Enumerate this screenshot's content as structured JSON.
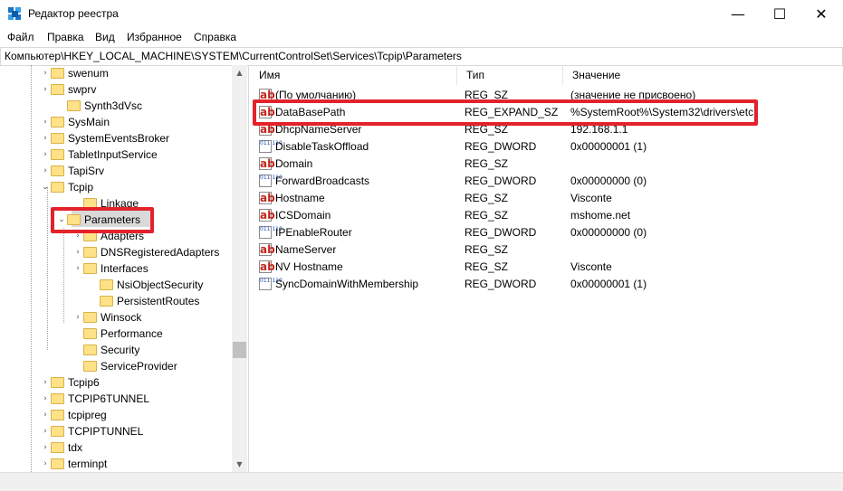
{
  "window": {
    "title": "Редактор реестра"
  },
  "controls": {
    "minimize": "—",
    "maximize": "☐",
    "close": "✕"
  },
  "menu": [
    "Файл",
    "Правка",
    "Вид",
    "Избранное",
    "Справка"
  ],
  "address": "Компьютер\\HKEY_LOCAL_MACHINE\\SYSTEM\\CurrentControlSet\\Services\\Tcpip\\Parameters",
  "tree": {
    "items": [
      {
        "label": "swenum",
        "chevron": "›"
      },
      {
        "label": "swprv",
        "chevron": "›"
      },
      {
        "label": "Synth3dVsc",
        "chevron": ""
      },
      {
        "label": "SysMain",
        "chevron": "›"
      },
      {
        "label": "SystemEventsBroker",
        "chevron": "›"
      },
      {
        "label": "TabletInputService",
        "chevron": "›"
      },
      {
        "label": "TapiSrv",
        "chevron": "›"
      },
      {
        "label": "Tcpip",
        "chevron": "⌄"
      },
      {
        "label": "Linkage",
        "chevron": ""
      },
      {
        "label": "Parameters",
        "chevron": "⌄"
      },
      {
        "label": "Adapters",
        "chevron": "›"
      },
      {
        "label": "DNSRegisteredAdapters",
        "chevron": "›"
      },
      {
        "label": "Interfaces",
        "chevron": "›"
      },
      {
        "label": "NsiObjectSecurity",
        "chevron": ""
      },
      {
        "label": "PersistentRoutes",
        "chevron": ""
      },
      {
        "label": "Winsock",
        "chevron": "›"
      },
      {
        "label": "Performance",
        "chevron": ""
      },
      {
        "label": "Security",
        "chevron": ""
      },
      {
        "label": "ServiceProvider",
        "chevron": ""
      },
      {
        "label": "Tcpip6",
        "chevron": "›"
      },
      {
        "label": "TCPIP6TUNNEL",
        "chevron": "›"
      },
      {
        "label": "tcpipreg",
        "chevron": "›"
      },
      {
        "label": "TCPIPTUNNEL",
        "chevron": "›"
      },
      {
        "label": "tdx",
        "chevron": "›"
      },
      {
        "label": "terminpt",
        "chevron": "›"
      }
    ]
  },
  "list": {
    "columns": {
      "name": "Имя",
      "type": "Тип",
      "value": "Значение"
    },
    "rows": [
      {
        "name": "(По умолчанию)",
        "type": "REG_SZ",
        "value": "(значение не присвоено)",
        "icon": "ab"
      },
      {
        "name": "DataBasePath",
        "type": "REG_EXPAND_SZ",
        "value": "%SystemRoot%\\System32\\drivers\\etc",
        "icon": "ab"
      },
      {
        "name": "DhcpNameServer",
        "type": "REG_SZ",
        "value": "192.168.1.1",
        "icon": "ab"
      },
      {
        "name": "DisableTaskOffload",
        "type": "REG_DWORD",
        "value": "0x00000001 (1)",
        "icon": "bin"
      },
      {
        "name": "Domain",
        "type": "REG_SZ",
        "value": "",
        "icon": "ab"
      },
      {
        "name": "ForwardBroadcasts",
        "type": "REG_DWORD",
        "value": "0x00000000 (0)",
        "icon": "bin"
      },
      {
        "name": "Hostname",
        "type": "REG_SZ",
        "value": "Visconte",
        "icon": "ab"
      },
      {
        "name": "ICSDomain",
        "type": "REG_SZ",
        "value": "mshome.net",
        "icon": "ab"
      },
      {
        "name": "IPEnableRouter",
        "type": "REG_DWORD",
        "value": "0x00000000 (0)",
        "icon": "bin"
      },
      {
        "name": "NameServer",
        "type": "REG_SZ",
        "value": "",
        "icon": "ab"
      },
      {
        "name": "NV Hostname",
        "type": "REG_SZ",
        "value": "Visconte",
        "icon": "ab"
      },
      {
        "name": "SyncDomainWithMembership",
        "type": "REG_DWORD",
        "value": "0x00000001 (1)",
        "icon": "bin"
      }
    ]
  },
  "icon_text": {
    "sz": "ab",
    "bin": "011 110"
  },
  "colors": {
    "highlight": "#e3222b",
    "folder": "#ffe287"
  }
}
